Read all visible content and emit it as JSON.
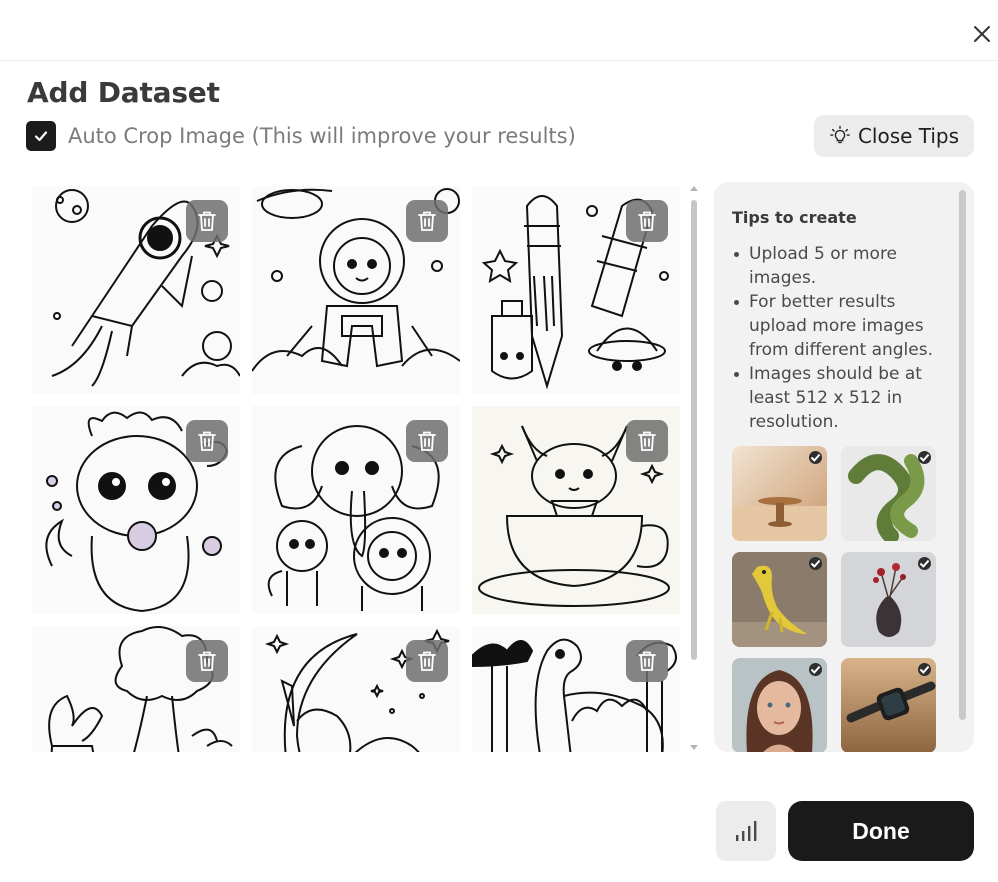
{
  "dialog": {
    "title": "Add Dataset",
    "close_icon": "close-icon"
  },
  "auto_crop": {
    "checked": true,
    "label": "Auto Crop Image (This will improve your results)"
  },
  "close_tips": {
    "label": "Close Tips",
    "icon": "lightbulb-icon"
  },
  "images": [
    {
      "subject": "rocket coloring page"
    },
    {
      "subject": "astronaut child coloring page"
    },
    {
      "subject": "pencil characters coloring page"
    },
    {
      "subject": "baby dragon coloring page"
    },
    {
      "subject": "elephant monkey lion coloring page"
    },
    {
      "subject": "kitten in teacup coloring page"
    },
    {
      "subject": "vegetables coloring page"
    },
    {
      "subject": "unicorn on moon coloring page"
    },
    {
      "subject": "dinosaur in jungle coloring page"
    }
  ],
  "tips": {
    "title": "Tips to create",
    "items": [
      "Upload 5 or more images.",
      "For better results upload more images from different angles.",
      "Images should be at least 512 x 512 in resolution."
    ],
    "examples": [
      {
        "subject": "wooden table",
        "color": "#d9b48f"
      },
      {
        "subject": "green knot",
        "color": "#6e8a45"
      },
      {
        "subject": "yellow lizard",
        "color": "#d9c24a"
      },
      {
        "subject": "vase with flowers",
        "color": "#c7c9cc"
      },
      {
        "subject": "woman portrait",
        "color": "#b98a70"
      },
      {
        "subject": "smart watch",
        "color": "#a47a52"
      }
    ]
  },
  "footer": {
    "stats_icon": "bar-chart-icon",
    "done_label": "Done"
  }
}
